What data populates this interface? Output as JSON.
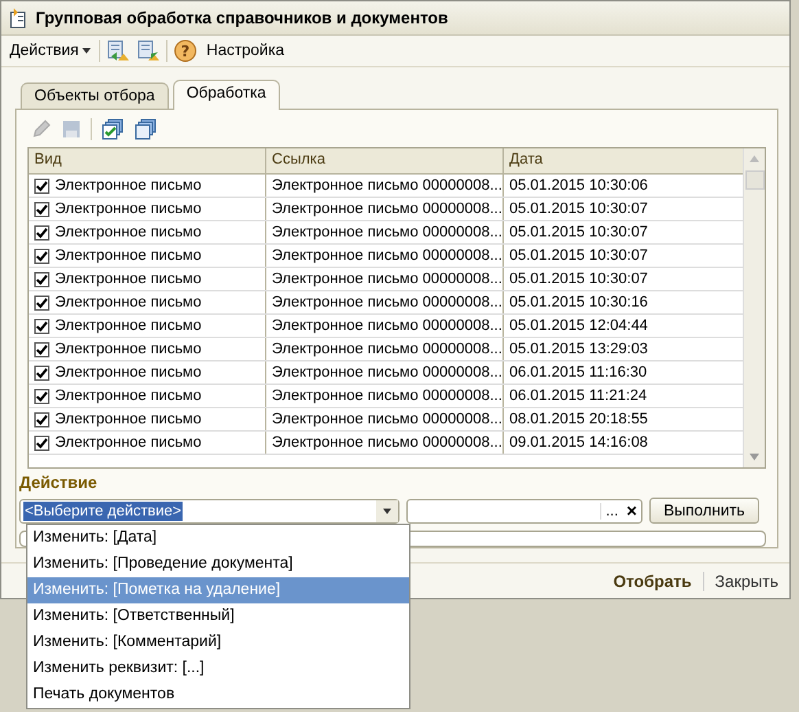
{
  "window": {
    "title": "Групповая обработка справочников и документов"
  },
  "toolbar": {
    "actions_menu": "Действия",
    "help": "?",
    "settings": "Настройка"
  },
  "tabs": [
    {
      "label": "Объекты отбора",
      "selected": false
    },
    {
      "label": "Обработка",
      "selected": true
    }
  ],
  "table": {
    "columns": [
      "Вид",
      "Ссылка",
      "Дата"
    ],
    "rows": [
      {
        "checked": true,
        "kind": "Электронное письмо",
        "ref": "Электронное письмо 00000008...",
        "date": "05.01.2015 10:30:06"
      },
      {
        "checked": true,
        "kind": "Электронное письмо",
        "ref": "Электронное письмо 00000008...",
        "date": "05.01.2015 10:30:07"
      },
      {
        "checked": true,
        "kind": "Электронное письмо",
        "ref": "Электронное письмо 00000008...",
        "date": "05.01.2015 10:30:07"
      },
      {
        "checked": true,
        "kind": "Электронное письмо",
        "ref": "Электронное письмо 00000008...",
        "date": "05.01.2015 10:30:07"
      },
      {
        "checked": true,
        "kind": "Электронное письмо",
        "ref": "Электронное письмо 00000008...",
        "date": "05.01.2015 10:30:07"
      },
      {
        "checked": true,
        "kind": "Электронное письмо",
        "ref": "Электронное письмо 00000008...",
        "date": "05.01.2015 10:30:16"
      },
      {
        "checked": true,
        "kind": "Электронное письмо",
        "ref": "Электронное письмо 00000008...",
        "date": "05.01.2015 12:04:44"
      },
      {
        "checked": true,
        "kind": "Электронное письмо",
        "ref": "Электронное письмо 00000008...",
        "date": "05.01.2015 13:29:03"
      },
      {
        "checked": true,
        "kind": "Электронное письмо",
        "ref": "Электронное письмо 00000008...",
        "date": "06.01.2015 11:16:30"
      },
      {
        "checked": true,
        "kind": "Электронное письмо",
        "ref": "Электронное письмо 00000008...",
        "date": "06.01.2015 11:21:24"
      },
      {
        "checked": true,
        "kind": "Электронное письмо",
        "ref": "Электронное письмо 00000008...",
        "date": "08.01.2015 20:18:55"
      },
      {
        "checked": true,
        "kind": "Электронное письмо",
        "ref": "Электронное письмо 00000008...",
        "date": "09.01.2015 14:16:08"
      }
    ]
  },
  "action": {
    "label": "Действие",
    "value": "<Выберите действие>",
    "choose_button": "...",
    "clear_button": "×",
    "run_button": "Выполнить",
    "progress": {
      "level": 0
    }
  },
  "dropdown": [
    {
      "label": "Изменить: [Дата]",
      "selected": false
    },
    {
      "label": "Изменить: [Проведение документа]",
      "selected": false
    },
    {
      "label": "Изменить: [Пометка на удаление]",
      "selected": true
    },
    {
      "label": "Изменить: [Ответственный]",
      "selected": false
    },
    {
      "label": "Изменить: [Комментарий]",
      "selected": false
    },
    {
      "label": "Изменить реквизит: [...]",
      "selected": false
    },
    {
      "label": "Печать документов",
      "selected": false
    }
  ],
  "footer": {
    "select_button": "Отобрать",
    "close_button": "Закрыть"
  }
}
